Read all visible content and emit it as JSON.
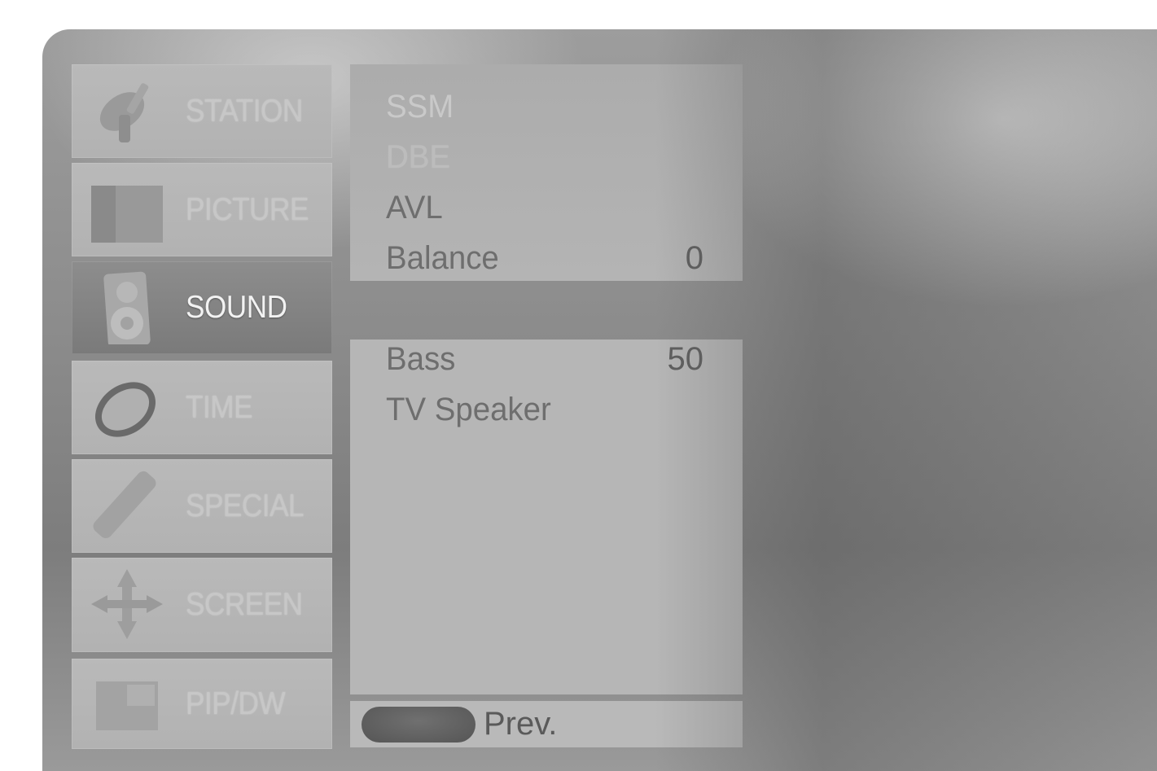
{
  "menu": {
    "items": [
      {
        "label": "STATION",
        "icon": "satellite-dish-icon",
        "active": false
      },
      {
        "label": "PICTURE",
        "icon": "picture-icon",
        "active": false
      },
      {
        "label": "SOUND",
        "icon": "speaker-icon",
        "active": true
      },
      {
        "label": "TIME",
        "icon": "clock-icon",
        "active": false
      },
      {
        "label": "SPECIAL",
        "icon": "remote-icon",
        "active": false
      },
      {
        "label": "SCREEN",
        "icon": "screen-adjust-icon",
        "active": false
      },
      {
        "label": "PIP/DW",
        "icon": "pip-icon",
        "active": false
      }
    ]
  },
  "sound_menu": {
    "top_rows": [
      {
        "label": "SSM",
        "value": ""
      },
      {
        "label": "DBE",
        "value": ""
      },
      {
        "label": "AVL",
        "value": ""
      },
      {
        "label": "Balance",
        "value": "0"
      }
    ],
    "bottom_rows": [
      {
        "label": "Bass",
        "value": "50"
      },
      {
        "label": "TV Speaker",
        "value": ""
      }
    ]
  },
  "footer": {
    "prev_label": "Prev."
  }
}
